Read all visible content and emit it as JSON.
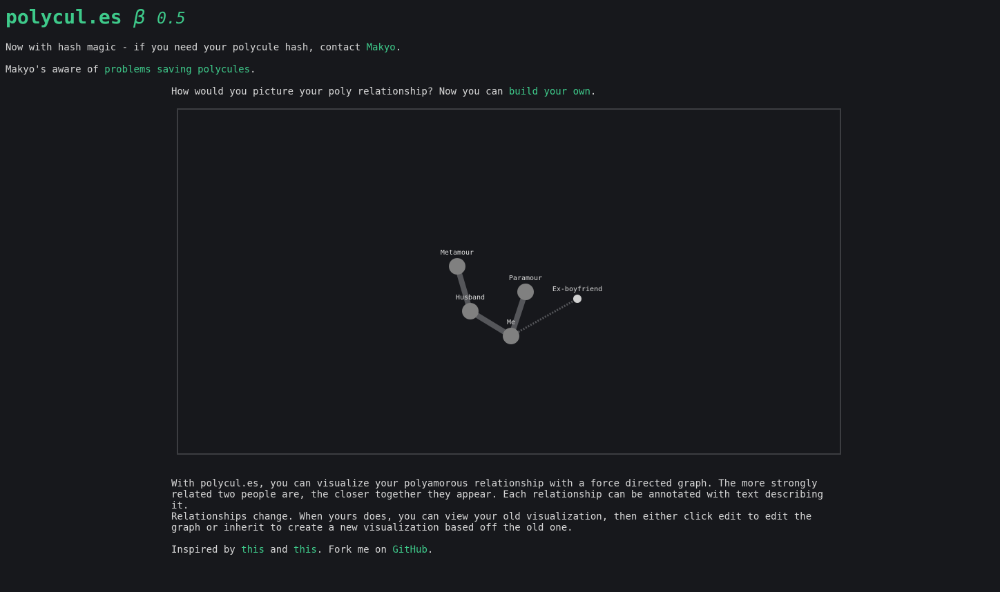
{
  "header": {
    "title": "polycul.es",
    "beta": "β",
    "version": "0.5"
  },
  "notices": {
    "hash_text": "Now with hash magic - if you need your polycule hash, contact ",
    "hash_link": "Makyo",
    "hash_end": ".",
    "aware_text": "Makyo's aware of ",
    "aware_link": "problems saving polycules",
    "aware_end": "."
  },
  "intro": {
    "text": "How would you picture your poly relationship? Now you can ",
    "link": "build your own",
    "end": "."
  },
  "graph": {
    "nodes": [
      {
        "id": "metamour",
        "label": "Metamour",
        "size": "large"
      },
      {
        "id": "husband",
        "label": "Husband",
        "size": "large"
      },
      {
        "id": "paramour",
        "label": "Paramour",
        "size": "large"
      },
      {
        "id": "exbf",
        "label": "Ex-boyfriend",
        "size": "small"
      },
      {
        "id": "me",
        "label": "Me",
        "size": "large"
      }
    ],
    "links": [
      {
        "source": "metamour",
        "target": "husband",
        "style": "solid"
      },
      {
        "source": "husband",
        "target": "me",
        "style": "solid"
      },
      {
        "source": "paramour",
        "target": "me",
        "style": "solid"
      },
      {
        "source": "exbf",
        "target": "me",
        "style": "dotted"
      }
    ],
    "colors": {
      "node": "#808080",
      "node_small": "#d0d0d0",
      "link": "#55565a",
      "label": "#d8d8d8"
    }
  },
  "description": {
    "p1": "With polycul.es, you can visualize your polyamorous relationship with a force directed graph. The more strongly related two people are, the closer together they appear. Each relationship can be annotated with text describing it.",
    "p2": "Relationships change. When yours does, you can view your old visualization, then either click edit to edit the graph or inherit to create a new visualization based off the old one."
  },
  "footer": {
    "inspired": "Inspired by ",
    "link1": "this",
    "and": " and ",
    "link2": "this",
    "fork": ". Fork me on ",
    "github": "GitHub",
    "end": "."
  },
  "colors": {
    "background": "#17181c",
    "accent": "#3ec98a",
    "text": "#d6d6d6",
    "border": "#3c3d41"
  }
}
